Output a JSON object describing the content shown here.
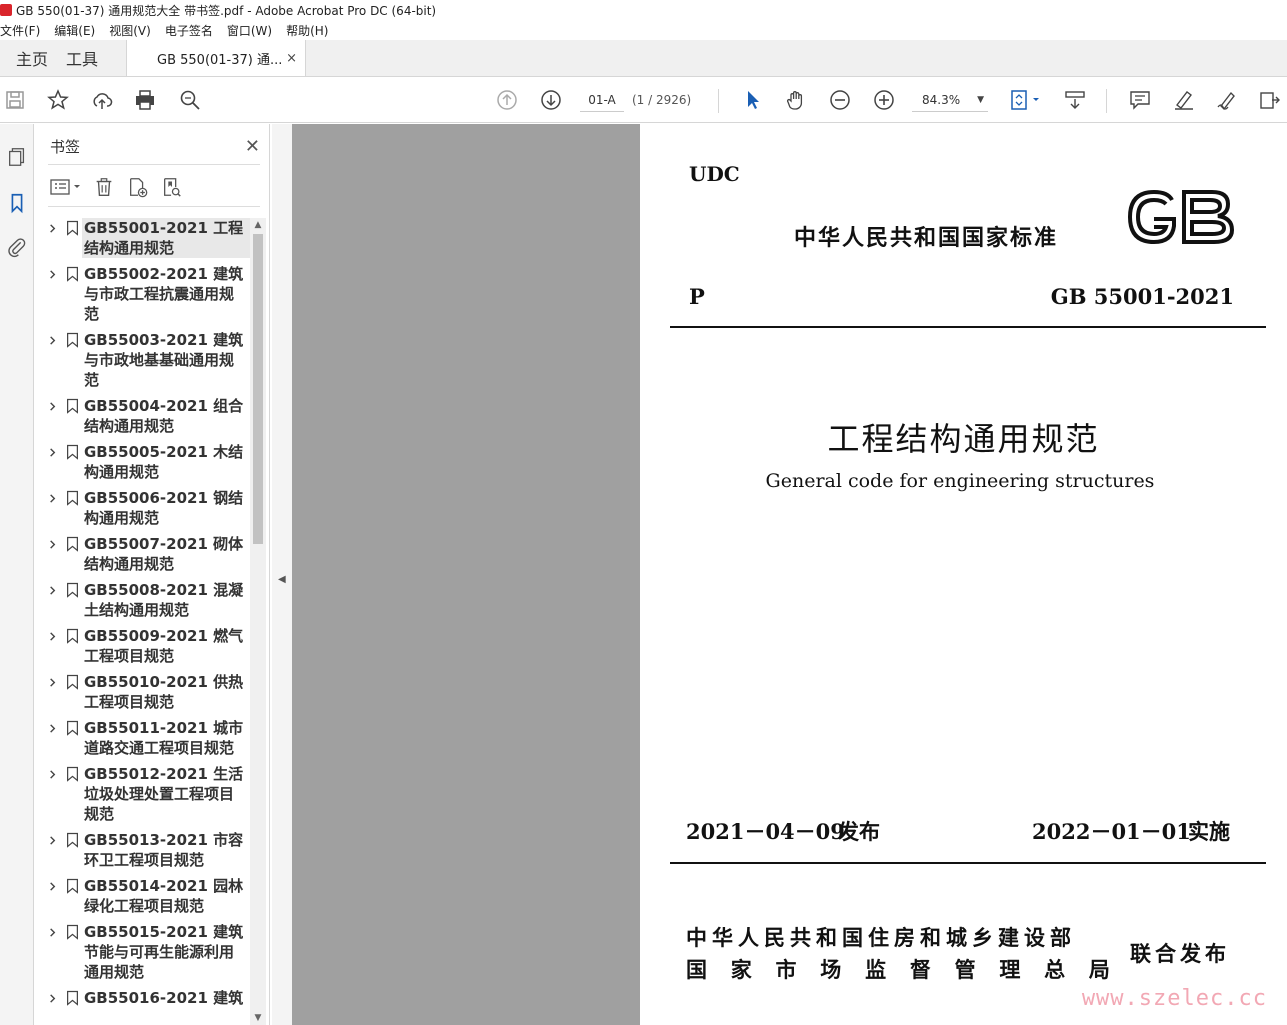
{
  "window": {
    "title": "GB 550(01-37) 通用规范大全 带书签.pdf - Adobe Acrobat Pro DC (64-bit)"
  },
  "menu": [
    "文件(F)",
    "编辑(E)",
    "视图(V)",
    "电子签名",
    "窗口(W)",
    "帮助(H)"
  ],
  "tabs": {
    "home": "主页",
    "tools": "工具",
    "document": "GB 550(01-37) 通...",
    "close": "×"
  },
  "toolbar": {
    "page_input": "01-A",
    "page_count": "(1 / 2926)",
    "zoom": "84.3%",
    "zoom_caret": "▼"
  },
  "bookmarks": {
    "title": "书签",
    "close": "✕",
    "items": [
      "GB55001-2021 工程结构通用规范",
      "GB55002-2021 建筑与市政工程抗震通用规范",
      "GB55003-2021 建筑与市政地基基础通用规范",
      "GB55004-2021 组合结构通用规范",
      "GB55005-2021 木结构通用规范",
      "GB55006-2021 钢结构通用规范",
      "GB55007-2021 砌体结构通用规范",
      "GB55008-2021 混凝土结构通用规范",
      "GB55009-2021 燃气工程项目规范",
      "GB55010-2021 供热工程项目规范",
      "GB55011-2021 城市道路交通工程项目规范",
      "GB55012-2021 生活垃圾处理处置工程项目规范",
      "GB55013-2021 市容环卫工程项目规范",
      "GB55014-2021 园林绿化工程项目规范",
      "GB55015-2021 建筑节能与可再生能源利用通用规范",
      "GB55016-2021 建筑"
    ]
  },
  "page": {
    "udc": "UDC",
    "standard_type": "中华人民共和国国家标准",
    "p_code": "P",
    "gb_number": "GB 55001-2021",
    "main_title": "工程结构通用规范",
    "english_title": "General code for engineering structures",
    "issue_date": "2021－04－09",
    "issue_label": "发布",
    "impl_date": "2022－01－01",
    "impl_label": "实施",
    "publisher_line1": "中华人民共和国住房和城乡建设部",
    "publisher_line2": [
      "国",
      "家",
      "市",
      "场",
      "监",
      "督",
      "管",
      "理",
      "总",
      "局"
    ],
    "joint_publish": "联合发布",
    "watermark": "www.szelec.cc"
  }
}
